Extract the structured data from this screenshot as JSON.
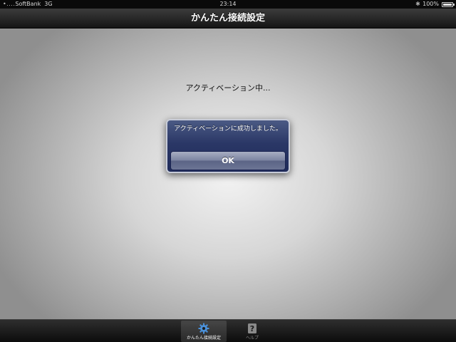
{
  "status_bar": {
    "signal": "•....",
    "carrier": "SoftBank",
    "network": "3G",
    "time": "23:14",
    "battery": "100%",
    "battery_level": 1.0
  },
  "nav": {
    "title": "かんたん接続設定"
  },
  "main": {
    "status_text": "アクティベーション中..."
  },
  "alert": {
    "message": "アクティベーションに成功しました。",
    "ok_label": "OK"
  },
  "tabs": [
    {
      "label": "かんたん接続設定",
      "icon": "gear-icon",
      "selected": true
    },
    {
      "label": "ヘルプ",
      "icon": "help-icon",
      "selected": false
    }
  ],
  "colors": {
    "alert_bg": "#2a3766",
    "tab_selected_icon": "#4a90d9",
    "tab_icon": "#8a8a8a"
  }
}
